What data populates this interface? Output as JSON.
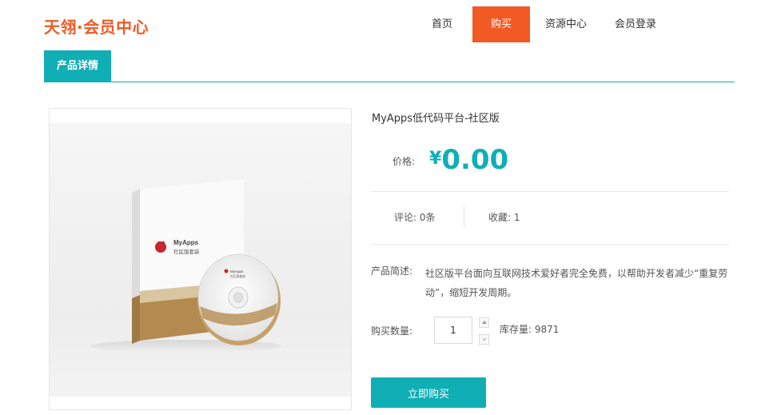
{
  "site": {
    "logo": "天翎·会员中心"
  },
  "nav": {
    "items": [
      {
        "label": "首页"
      },
      {
        "label": "购买",
        "active": true
      },
      {
        "label": "资源中心"
      },
      {
        "label": "会员登录"
      }
    ]
  },
  "tabs": [
    {
      "label": "产品详情",
      "active": true
    }
  ],
  "product": {
    "title": "MyApps低代码平台-社区版",
    "price_label": "价格:",
    "currency_symbol": "¥",
    "price": "0.00",
    "comments": "评论: 0条",
    "favorites": "收藏: 1",
    "desc_label": "产品简述:",
    "description": "社区版平台面向互联网技术爱好者完全免费，以帮助开发者减少“重复劳动”，缩短开发周期。",
    "quantity_label": "购买数量:",
    "quantity": "1",
    "stock": "库存量: 9871",
    "buy_button": "立即购买",
    "image": {
      "box_brand": "MyApps",
      "box_sub": "社区版套装",
      "disc_brand": "MyApps",
      "disc_sub": "社区版套装"
    }
  },
  "colors": {
    "accent": "#10aeb5",
    "brand": "#f15a24"
  }
}
